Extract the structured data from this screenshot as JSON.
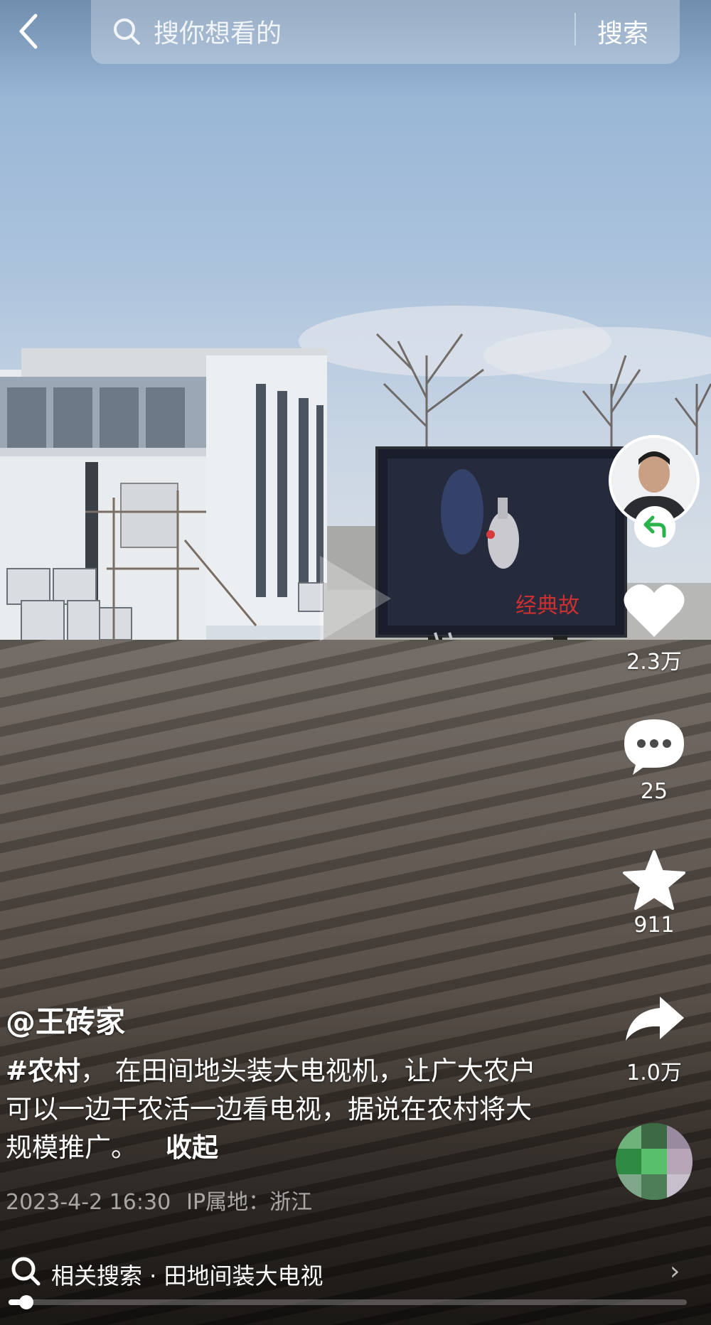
{
  "search": {
    "placeholder": "搜你想看的",
    "button": "搜索"
  },
  "author": {
    "handle": "@王砖家"
  },
  "description": {
    "tag": "#农村",
    "text": "，  在田间地头装大电视机，让广大农户可以一边干农活一边看电视，据说在农村将大规模推广。",
    "collapse": "收起"
  },
  "meta": {
    "datetime": "2023-4-2 16:30",
    "ip_location": "IP属地：浙江"
  },
  "screen_caption": "经典故",
  "actions": {
    "likes": "2.3万",
    "comments": "25",
    "favorites": "911",
    "shares": "1.0万"
  },
  "related": {
    "text": "相关搜索 · 田地间装大电视"
  },
  "playback": {
    "progress": 0.02
  },
  "colors": {
    "follow_accent": "#2bb24c"
  },
  "icons": [
    "back-arrow-icon",
    "search-icon",
    "follow-icon",
    "heart-icon",
    "comment-icon",
    "star-icon",
    "share-icon",
    "chevron-right-icon",
    "play-icon"
  ]
}
